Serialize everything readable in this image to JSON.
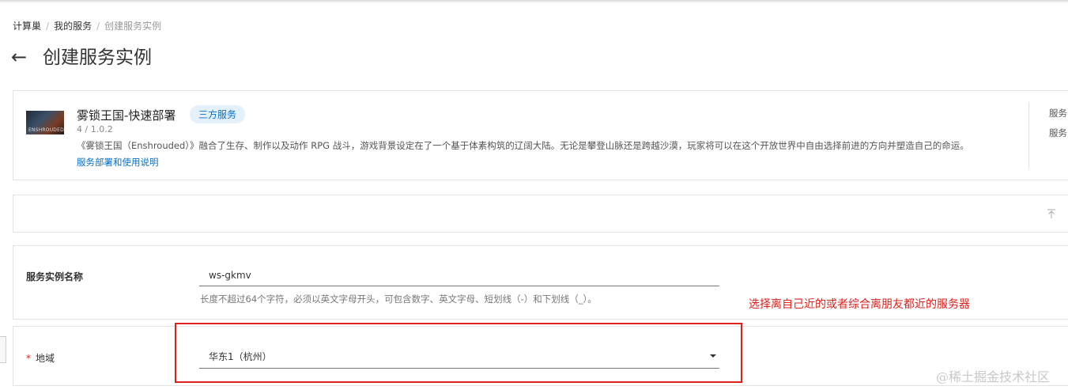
{
  "breadcrumb": [
    "计算巢",
    "我的服务",
    "创建服务实例"
  ],
  "page": {
    "back_icon": "arrow-left-icon",
    "title": "创建服务实例"
  },
  "service": {
    "name": "雾锁王国-快速部署",
    "tag": "三方服务",
    "version": "4 / 1.0.2",
    "description": "《雾锁王国（Enshrouded）》融合了生存、制作以及动作 RPG 战斗，游戏背景设定在了一个基于体素构筑的辽阔大陆。无论是攀登山脉还是跨越沙漠，玩家将可以在这个开放世界中自由选择前进的方向并塑造自己的命运。",
    "doc_link": "服务部署和使用说明",
    "thumb_text": "ENSHROUDED",
    "right_labels": [
      "服务",
      "服务"
    ]
  },
  "form": {
    "instance_name": {
      "label": "服务实例名称",
      "value": "ws-gkmv",
      "help": "长度不超过64个字符，必须以英文字母开头，可包含数字、英文字母、短划线（-）和下划线（_）。"
    },
    "region": {
      "required_mark": "*",
      "label": "地域",
      "value": "华东1（杭州）"
    }
  },
  "annotation": {
    "text": "选择离自己近的或者综合离朋友都近的服务器",
    "color": "#e0201c"
  },
  "watermark": "@稀土掘金技术社区",
  "colors": {
    "link": "#0070cc",
    "tag_bg": "#e4f1fb",
    "accent_red": "#e0201c"
  }
}
